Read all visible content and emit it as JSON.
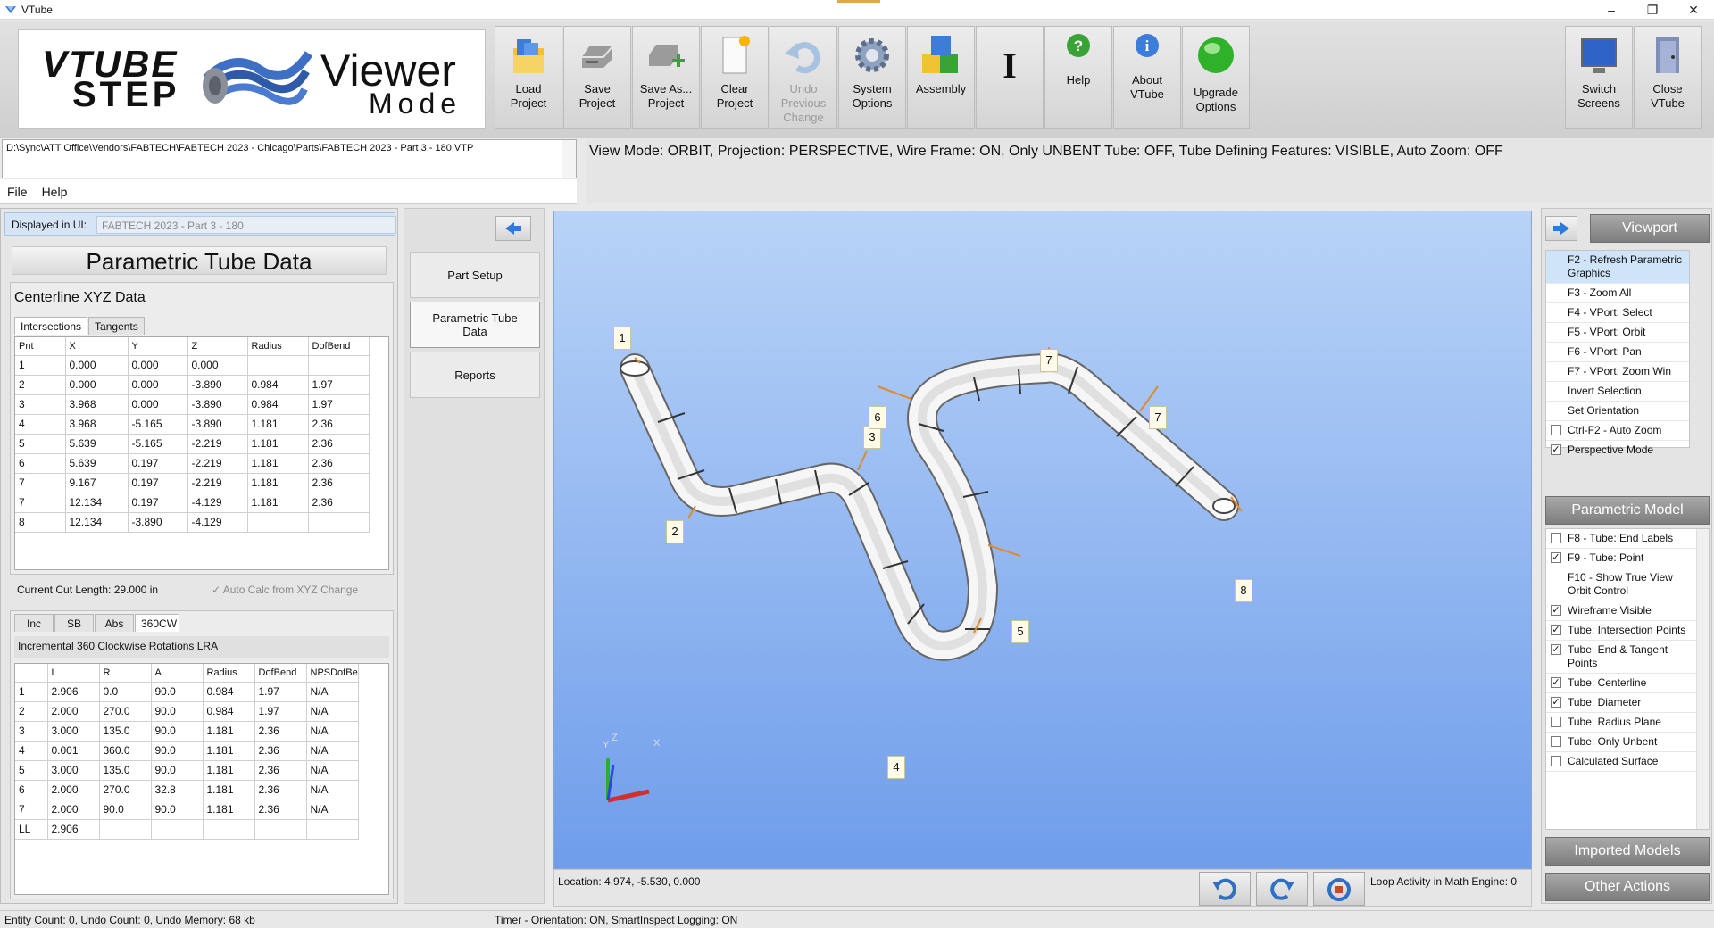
{
  "window": {
    "title": "VTube"
  },
  "logo": {
    "vtube": "VTUBE",
    "step": "STEP",
    "viewer": "Viewer",
    "mode": "Mode"
  },
  "toolbar": {
    "buttons": [
      {
        "label": "Load\nProject",
        "icon": "folder-icon",
        "enabled": true
      },
      {
        "label": "Save\nProject",
        "icon": "drive-icon",
        "enabled": true
      },
      {
        "label": "Save As...\nProject",
        "icon": "drive-plus-icon",
        "enabled": true
      },
      {
        "label": "Clear\nProject",
        "icon": "new-document-icon",
        "enabled": true
      },
      {
        "label": "Undo\nPrevious\nChange",
        "icon": "undo-icon",
        "enabled": false
      },
      {
        "label": "System\nOptions",
        "icon": "gear-icon",
        "enabled": true
      },
      {
        "label": "Assembly",
        "icon": "cubes-icon",
        "enabled": true
      },
      {
        "label": "",
        "icon": "text-cursor-icon",
        "enabled": true
      },
      {
        "label": "Help",
        "icon": "help-icon",
        "enabled": true
      },
      {
        "label": "About\nVTube",
        "icon": "info-icon",
        "enabled": true
      },
      {
        "label": "Upgrade\nOptions",
        "icon": "green-orb-icon",
        "enabled": true
      }
    ],
    "right_buttons": [
      {
        "label": "Switch\nScreens",
        "icon": "monitor-icon"
      },
      {
        "label": "Close\nVTube",
        "icon": "exit-door-icon"
      }
    ]
  },
  "file_path": "D:\\Sync\\ATT Office\\Vendors\\FABTECH\\FABTECH 2023 - Chicago\\Parts\\FABTECH 2023 - Part 3 - 180.VTP",
  "menu": [
    "File",
    "Help"
  ],
  "view_mode_text": "View Mode: ORBIT, Projection: PERSPECTIVE, Wire Frame: ON, Only UNBENT Tube: OFF, Tube Defining Features: VISIBLE, Auto Zoom: OFF",
  "left": {
    "displayed_label": "Displayed in UI:",
    "displayed_value": "FABTECH 2023 - Part 3 - 180",
    "title": "Parametric Tube Data",
    "centerline_title": "Centerline XYZ Data",
    "tabs": [
      "Intersections",
      "Tangents"
    ],
    "xyz": {
      "headers": [
        "Pnt",
        "X",
        "Y",
        "Z",
        "Radius",
        "DofBend"
      ],
      "rows": [
        [
          "1",
          "0.000",
          "0.000",
          "0.000",
          "",
          ""
        ],
        [
          "2",
          "0.000",
          "0.000",
          "-3.890",
          "0.984",
          "1.97"
        ],
        [
          "3",
          "3.968",
          "0.000",
          "-3.890",
          "0.984",
          "1.97"
        ],
        [
          "4",
          "3.968",
          "-5.165",
          "-3.890",
          "1.181",
          "2.36"
        ],
        [
          "5",
          "5.639",
          "-5.165",
          "-2.219",
          "1.181",
          "2.36"
        ],
        [
          "6",
          "5.639",
          "0.197",
          "-2.219",
          "1.181",
          "2.36"
        ],
        [
          "7",
          "9.167",
          "0.197",
          "-2.219",
          "1.181",
          "2.36"
        ],
        [
          "7",
          "12.134",
          "0.197",
          "-4.129",
          "1.181",
          "2.36"
        ],
        [
          "8",
          "12.134",
          "-3.890",
          "-4.129",
          "",
          ""
        ]
      ]
    },
    "cut_length": "Current Cut Length:  29.000 in",
    "auto_calc": "Auto Calc from XYZ Change",
    "lra_tabs": [
      "Inc",
      "SB",
      "Abs",
      "360CW"
    ],
    "lra_title": "Incremental 360 Clockwise Rotations LRA",
    "lra": {
      "headers": [
        "",
        "L",
        "R",
        "A",
        "Radius",
        "DofBend",
        "NPSDofBe"
      ],
      "rows": [
        [
          "1",
          "2.906",
          "0.0",
          "90.0",
          "0.984",
          "1.97",
          "N/A"
        ],
        [
          "2",
          "2.000",
          "270.0",
          "90.0",
          "0.984",
          "1.97",
          "N/A"
        ],
        [
          "3",
          "3.000",
          "135.0",
          "90.0",
          "1.181",
          "2.36",
          "N/A"
        ],
        [
          "4",
          "0.001",
          "360.0",
          "90.0",
          "1.181",
          "2.36",
          "N/A"
        ],
        [
          "5",
          "3.000",
          "135.0",
          "90.0",
          "1.181",
          "2.36",
          "N/A"
        ],
        [
          "6",
          "2.000",
          "270.0",
          "32.8",
          "1.181",
          "2.36",
          "N/A"
        ],
        [
          "7",
          "2.000",
          "90.0",
          "90.0",
          "1.181",
          "2.36",
          "N/A"
        ],
        [
          "LL",
          "2.906",
          "",
          "",
          "",
          "",
          ""
        ]
      ]
    }
  },
  "middle": {
    "buttons": [
      "Part Setup",
      "Parametric Tube\nData",
      "Reports"
    ]
  },
  "viewport": {
    "labels": [
      "1",
      "2",
      "3",
      "4",
      "5",
      "6",
      "7",
      "7",
      "8"
    ],
    "axis_x": "X",
    "axis_y": "Y",
    "axis_z": "Z",
    "location": "Location: 4.974, -5.530, 0.000",
    "loop": "Loop Activity in Math Engine:  0"
  },
  "right": {
    "viewport_btn": "Viewport",
    "viewport_items": [
      {
        "label": "F2 - Refresh Parametric Graphics",
        "checkbox": false,
        "selected": true
      },
      {
        "label": "F3 - Zoom All",
        "checkbox": false
      },
      {
        "label": "F4 - VPort: Select",
        "checkbox": false
      },
      {
        "label": "F5 - VPort: Orbit",
        "checkbox": false
      },
      {
        "label": "F6 - VPort: Pan",
        "checkbox": false
      },
      {
        "label": "F7 - VPort: Zoom Win",
        "checkbox": false
      },
      {
        "label": "Invert Selection",
        "checkbox": false
      },
      {
        "label": "Set Orientation",
        "checkbox": false
      },
      {
        "label": "Ctrl-F2 - Auto Zoom",
        "checkbox": true,
        "checked": false
      },
      {
        "label": "Perspective Mode",
        "checkbox": true,
        "checked": true
      }
    ],
    "param_btn": "Parametric Model",
    "param_items": [
      {
        "label": "F8 - Tube: End Labels",
        "checked": false
      },
      {
        "label": "F9 - Tube: Point",
        "checked": true
      },
      {
        "label": "F10 - Show True View Orbit Control",
        "checked": false,
        "nobox": true
      },
      {
        "label": "Wireframe Visible",
        "checked": true
      },
      {
        "label": "Tube: Intersection Points",
        "checked": true
      },
      {
        "label": "Tube: End & Tangent Points",
        "checked": true
      },
      {
        "label": "Tube: Centerline",
        "checked": true
      },
      {
        "label": "Tube: Diameter",
        "checked": true
      },
      {
        "label": "Tube: Radius Plane",
        "checked": false
      },
      {
        "label": "Tube: Only Unbent",
        "checked": false
      },
      {
        "label": "Calculated Surface",
        "checked": false
      }
    ],
    "imported_btn": "Imported Models",
    "other_btn": "Other Actions"
  },
  "status": {
    "left": "Entity Count: 0, Undo Count: 0, Undo Memory: 68 kb",
    "mid": "Timer - Orientation: ON, SmartInspect Logging: ON"
  }
}
